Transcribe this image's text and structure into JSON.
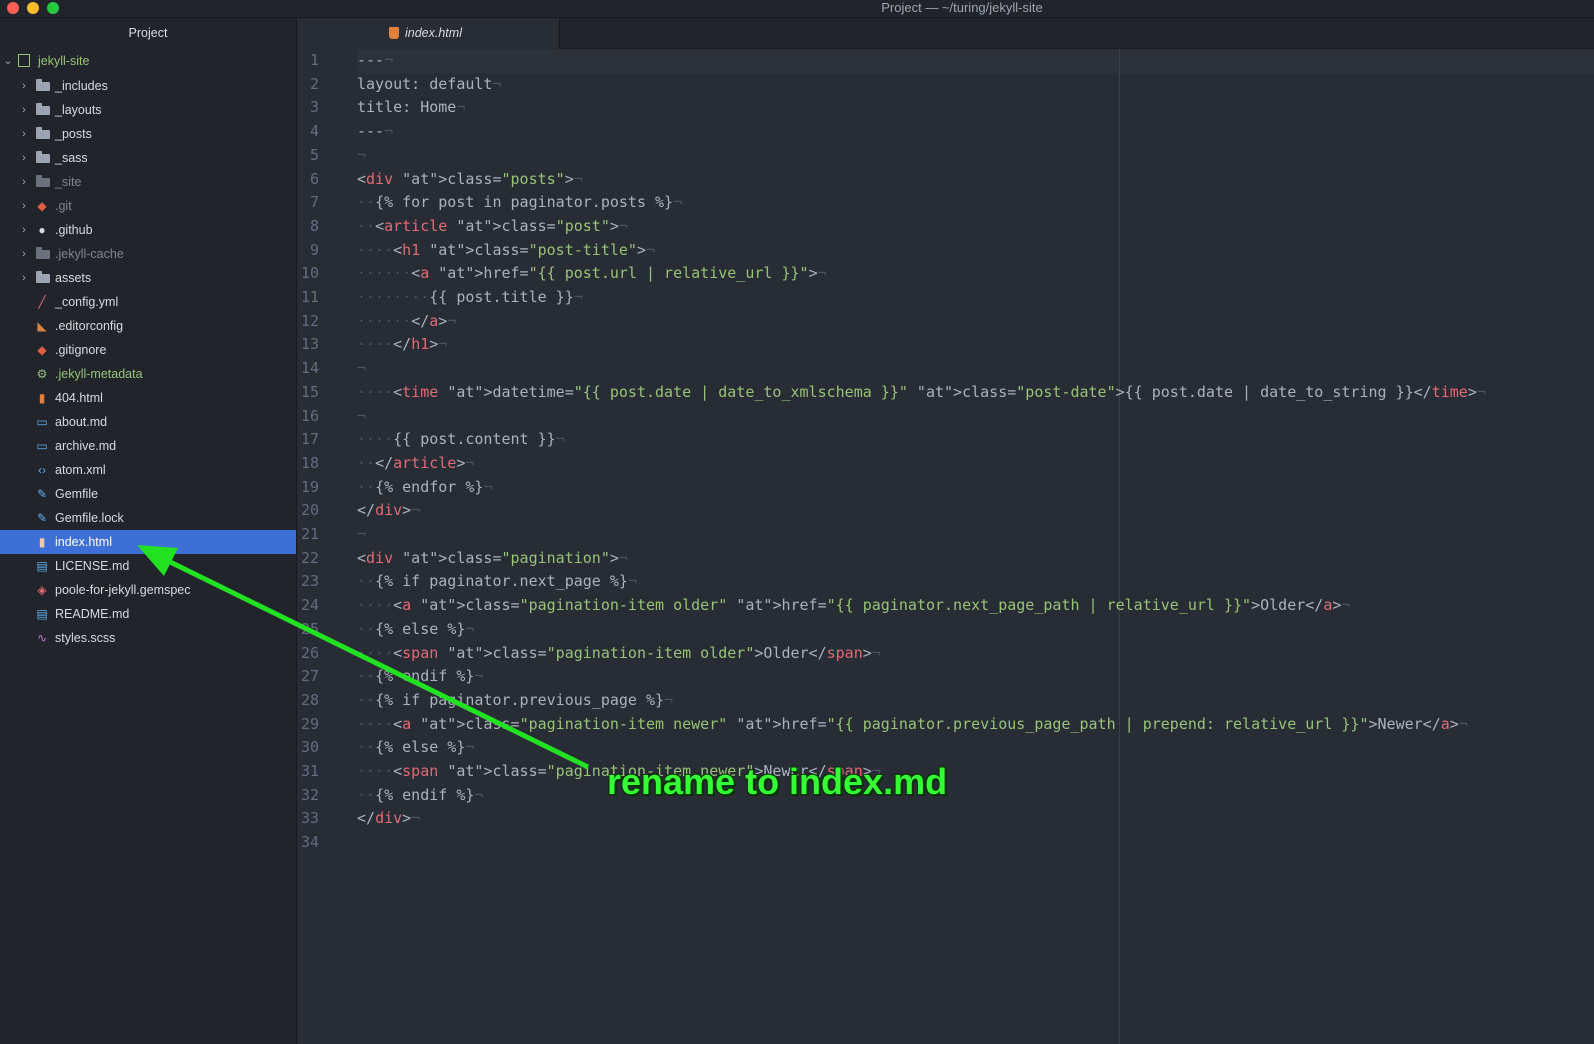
{
  "window": {
    "title": "Project — ~/turing/jekyll-site"
  },
  "sidebar": {
    "header": "Project",
    "root": "jekyll-site",
    "items": [
      {
        "label": "_includes",
        "type": "folder",
        "icon": "folder-icon"
      },
      {
        "label": "_layouts",
        "type": "folder",
        "icon": "folder-icon"
      },
      {
        "label": "_posts",
        "type": "folder",
        "icon": "folder-icon"
      },
      {
        "label": "_sass",
        "type": "folder",
        "icon": "folder-icon"
      },
      {
        "label": "_site",
        "type": "folder",
        "icon": "folder-icon",
        "dim": true
      },
      {
        "label": ".git",
        "type": "folder",
        "icon": "git-icon",
        "dim": true
      },
      {
        "label": ".github",
        "type": "folder",
        "icon": "github-icon"
      },
      {
        "label": ".jekyll-cache",
        "type": "folder",
        "icon": "folder-icon",
        "dim": true
      },
      {
        "label": "assets",
        "type": "folder",
        "icon": "folder-icon"
      },
      {
        "label": "_config.yml",
        "type": "file",
        "icon": "config-file-icon"
      },
      {
        "label": ".editorconfig",
        "type": "file",
        "icon": "editorconfig-icon"
      },
      {
        "label": ".gitignore",
        "type": "file",
        "icon": "git-icon"
      },
      {
        "label": ".jekyll-metadata",
        "type": "file",
        "icon": "gear-icon",
        "green": true
      },
      {
        "label": "404.html",
        "type": "file",
        "icon": "html5-icon"
      },
      {
        "label": "about.md",
        "type": "file",
        "icon": "markdown-icon"
      },
      {
        "label": "archive.md",
        "type": "file",
        "icon": "markdown-icon"
      },
      {
        "label": "atom.xml",
        "type": "file",
        "icon": "code-icon"
      },
      {
        "label": "Gemfile",
        "type": "file",
        "icon": "bundler-icon"
      },
      {
        "label": "Gemfile.lock",
        "type": "file",
        "icon": "bundler-icon"
      },
      {
        "label": "index.html",
        "type": "file",
        "icon": "html5-icon",
        "selected": true
      },
      {
        "label": "LICENSE.md",
        "type": "file",
        "icon": "book-icon"
      },
      {
        "label": "poole-for-jekyll.gemspec",
        "type": "file",
        "icon": "ruby-icon"
      },
      {
        "label": "README.md",
        "type": "file",
        "icon": "book-icon"
      },
      {
        "label": "styles.scss",
        "type": "file",
        "icon": "sass-icon"
      }
    ]
  },
  "tab": {
    "label": "index.html",
    "icon": "html5-icon"
  },
  "editor": {
    "lines": [
      "---",
      "layout: default",
      "title: Home",
      "---",
      "",
      "<div class=\"posts\">",
      "  {% for post in paginator.posts %}",
      "  <article class=\"post\">",
      "    <h1 class=\"post-title\">",
      "      <a href=\"{{ post.url | relative_url }}\">",
      "        {{ post.title }}",
      "      </a>",
      "    </h1>",
      "",
      "    <time datetime=\"{{ post.date | date_to_xmlschema }}\" class=\"post-date\">{{ post.date | date_to_string }}</time>",
      "",
      "    {{ post.content }}",
      "  </article>",
      "  {% endfor %}",
      "</div>",
      "",
      "<div class=\"pagination\">",
      "  {% if paginator.next_page %}",
      "    <a class=\"pagination-item older\" href=\"{{ paginator.next_page_path | relative_url }}\">Older</a>",
      "  {% else %}",
      "    <span class=\"pagination-item older\">Older</span>",
      "  {% endif %}",
      "  {% if paginator.previous_page %}",
      "    <a class=\"pagination-item newer\" href=\"{{ paginator.previous_page_path | prepend: relative_url }}\">Newer</a>",
      "  {% else %}",
      "    <span class=\"pagination-item newer\">Newer</span>",
      "  {% endif %}",
      "</div>",
      ""
    ]
  },
  "annotation": {
    "text": "rename to index.md",
    "color": "#35ff35"
  },
  "colors": {
    "tag": "#e06c75",
    "attribute": "#d19a66",
    "string": "#98c379",
    "selection": "#3e6fd6"
  }
}
